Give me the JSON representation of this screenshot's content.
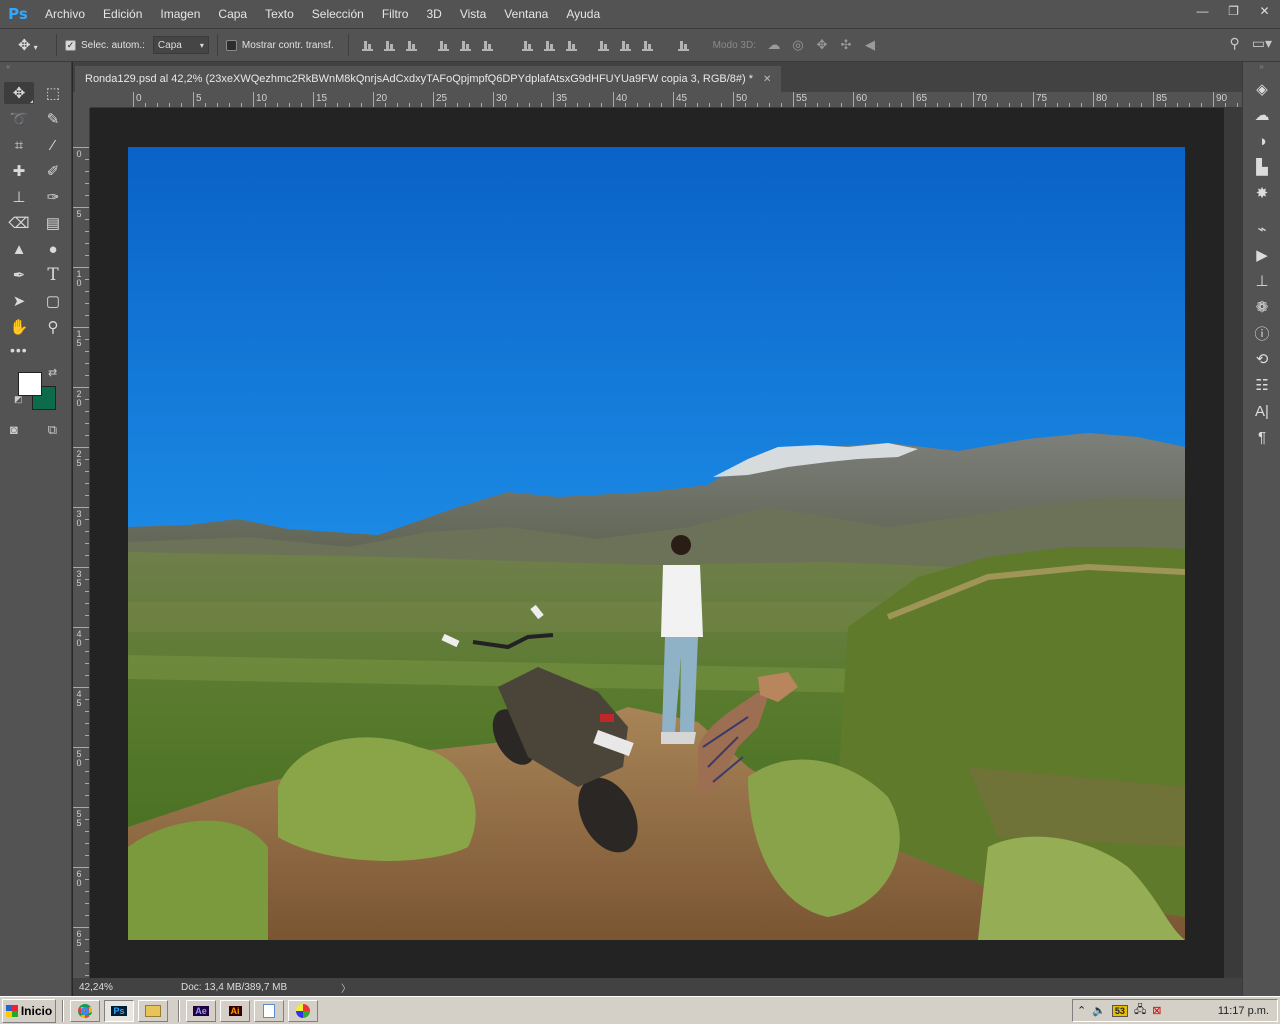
{
  "app": {
    "logo": "Ps",
    "brand_color": "#31a8ff"
  },
  "menu": [
    "Archivo",
    "Edición",
    "Imagen",
    "Capa",
    "Texto",
    "Selección",
    "Filtro",
    "3D",
    "Vista",
    "Ventana",
    "Ayuda"
  ],
  "window_controls": {
    "minimize": "—",
    "restore": "❐",
    "close": "✕"
  },
  "options": {
    "auto_select_label": "Selec. autom.:",
    "auto_select_checked": true,
    "auto_select_target": "Capa",
    "show_transform_label": "Mostrar contr. transf.",
    "show_transform_checked": false,
    "mode3d_label": "Modo 3D:"
  },
  "document": {
    "tab_title": "Ronda129.psd al 42,2% (23xeXWQezhmc2RkBWnM8kQnrjsAdCxdxyTAFoQpjmpfQ6DPYdplafAtsxG9dHFUYUa9FW copia 3, RGB/8#) *",
    "close_icon": "✕"
  },
  "ruler": {
    "top_labels": [
      "0",
      "5",
      "10",
      "15",
      "20",
      "25",
      "30",
      "35",
      "40",
      "45",
      "50",
      "55",
      "60",
      "65",
      "70",
      "75",
      "80",
      "85",
      "90"
    ],
    "left_labels": [
      "0",
      "5",
      "10",
      "15",
      "20",
      "25",
      "30",
      "35",
      "40",
      "45",
      "50",
      "55",
      "60",
      "65"
    ]
  },
  "colors": {
    "foreground": "#ffffff",
    "background": "#0c6b4b"
  },
  "status": {
    "zoom": "42,24%",
    "doc_info": "Doc: 13,4 MB/389,7 MB",
    "arrow": "〉"
  },
  "taskbar": {
    "start_label": "Inicio",
    "apps": [
      "chrome-icon",
      "photoshop-icon",
      "explorer-icon",
      "aftereffects-icon",
      "illustrator-icon",
      "notepad-icon",
      "paint-icon"
    ],
    "app_labels": {
      "photoshop": "Ps",
      "aftereffects": "Ae",
      "illustrator": "Ai"
    },
    "tray_badge": "53",
    "clock": "11:17 p.m."
  }
}
